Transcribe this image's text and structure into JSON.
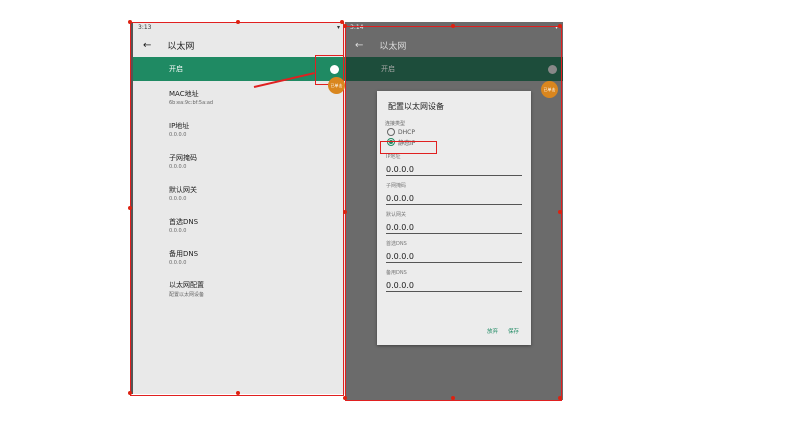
{
  "left": {
    "time": "3:13",
    "title": "以太网",
    "switch_label": "开启",
    "items": [
      {
        "title": "MAC地址",
        "sub": "6b:ea:9c:bf:5a:ad"
      },
      {
        "title": "IP地址",
        "sub": "0.0.0.0"
      },
      {
        "title": "子网掩码",
        "sub": "0.0.0.0"
      },
      {
        "title": "默认网关",
        "sub": "0.0.0.0"
      },
      {
        "title": "首选DNS",
        "sub": "0.0.0.0"
      },
      {
        "title": "备用DNS",
        "sub": "0.0.0.0"
      },
      {
        "title": "以太网配置",
        "sub": "配置以太网设备"
      }
    ],
    "badge": "已单击"
  },
  "right": {
    "time": "3:14",
    "title": "以太网",
    "switch_label": "开启",
    "badge": "已单击",
    "dialog": {
      "title": "配置以太网设备",
      "conn_type_label": "连接类型",
      "option_dhcp": "DHCP",
      "option_static": "静态IP",
      "fields": [
        {
          "label": "IP地址",
          "value": "0.0.0.0"
        },
        {
          "label": "子网掩码",
          "value": "0.0.0.0"
        },
        {
          "label": "默认网关",
          "value": "0.0.0.0"
        },
        {
          "label": "首选DNS",
          "value": "0.0.0.0"
        },
        {
          "label": "备用DNS",
          "value": "0.0.0.0"
        }
      ],
      "cancel": "放弃",
      "save": "保存"
    }
  },
  "colors": {
    "accent": "#1f8a63",
    "highlight": "#e02020",
    "badge": "#d9861e"
  }
}
